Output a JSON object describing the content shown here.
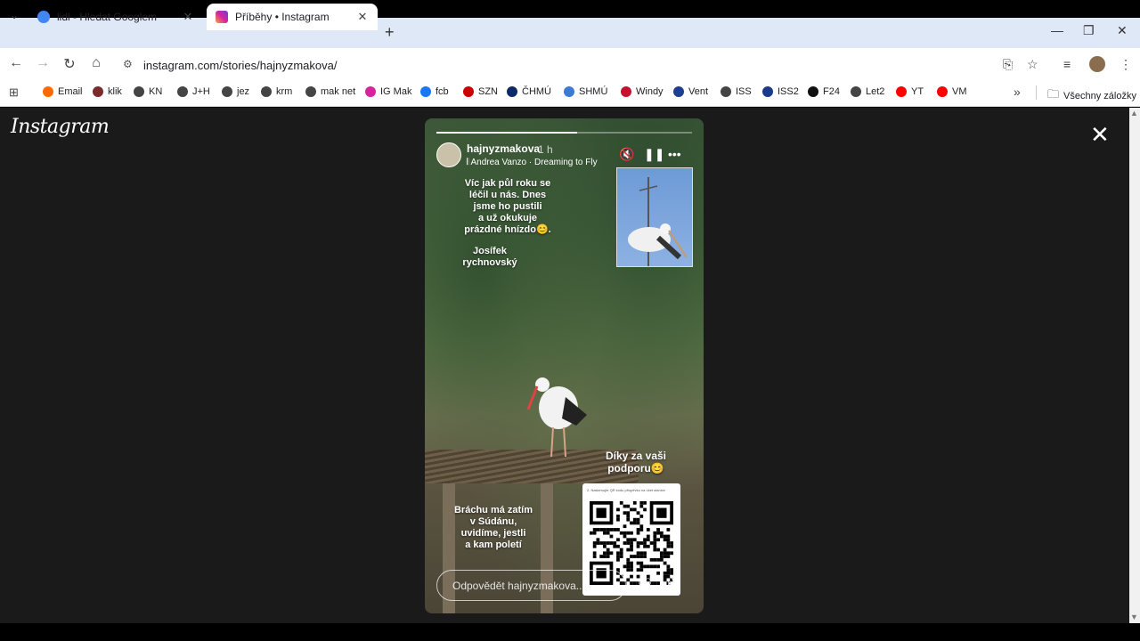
{
  "browser": {
    "tabs": [
      {
        "title": "lidl - Hledat Googlem",
        "favicon_color": "#4285f4"
      },
      {
        "title": "Příběhy • Instagram",
        "favicon_color": "#d6249f"
      }
    ],
    "url": "instagram.com/stories/hajnyzmakova/",
    "bookmarks": [
      {
        "label": "Email",
        "color": "#ff6a00"
      },
      {
        "label": "klik",
        "color": "#7a2b2b"
      },
      {
        "label": "KN",
        "color": "#444444"
      },
      {
        "label": "J+H",
        "color": "#444444"
      },
      {
        "label": "jez",
        "color": "#444444"
      },
      {
        "label": "krm",
        "color": "#444444"
      },
      {
        "label": "mak net",
        "color": "#444444"
      },
      {
        "label": "IG Mak",
        "color": "#d6249f"
      },
      {
        "label": "fcb",
        "color": "#1877f2"
      },
      {
        "label": "SZN",
        "color": "#cc0000"
      },
      {
        "label": "ČHMÚ",
        "color": "#0a2a6b"
      },
      {
        "label": "SHMÚ",
        "color": "#3a7bd5"
      },
      {
        "label": "Windy",
        "color": "#c8102e"
      },
      {
        "label": "Vent",
        "color": "#1d3f8f"
      },
      {
        "label": "ISS",
        "color": "#444444"
      },
      {
        "label": "ISS2",
        "color": "#1b3a8a"
      },
      {
        "label": "F24",
        "color": "#111111"
      },
      {
        "label": "Let2",
        "color": "#444444"
      },
      {
        "label": "YT",
        "color": "#ff0000"
      },
      {
        "label": "VM",
        "color": "#ff0000"
      }
    ],
    "all_bookmarks_label": "Všechny záložky"
  },
  "instagram": {
    "logo": "Instagram",
    "story": {
      "username": "hajnyzmakova",
      "time": "1 h",
      "music": "Andrea Vanzo · Dreaming to Fly",
      "progress": 0.55,
      "text_top": "Víc jak půl roku se\nléčil u nás. Dnes\njsme ho pustili\na už okukuje\nprázdné hnízdo😊.",
      "text_name": "Josífek\nrychnovský",
      "text_thanks": "Díky za vaši\npodporu😊",
      "text_brother": "Bráchu má zatím\nv Súdánu,\nuvidíme, jestli\na kam poletí",
      "qr_caption": "2. Naskenujte QR kódu příspěvku na účet stanice",
      "reply_placeholder": "Odpovědět hajnyzmakova..."
    }
  }
}
